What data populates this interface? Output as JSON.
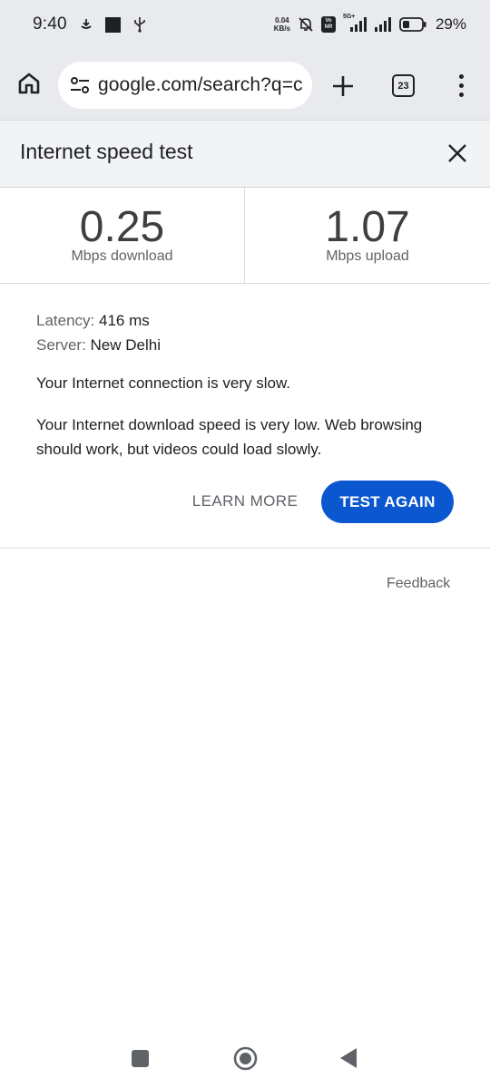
{
  "status_bar": {
    "time": "9:40",
    "net_speed_value": "0.04",
    "net_speed_unit": "KB/s",
    "signal_label": "5G+",
    "vo_top": "Vo",
    "vo_bottom": "NR",
    "battery_percent": "29%",
    "icons": [
      "download-icon",
      "square-notification-icon",
      "usb-icon",
      "mute-icon",
      "signal-icon",
      "battery-icon"
    ]
  },
  "toolbar": {
    "url": "google.com/search?q=c",
    "tab_count": "23",
    "icons": [
      "home-icon",
      "tune-icon",
      "plus-icon",
      "menu-dots-icon"
    ]
  },
  "panel": {
    "title": "Internet speed test",
    "download": {
      "value": "0.25",
      "unit": "Mbps download"
    },
    "upload": {
      "value": "1.07",
      "unit": "Mbps upload"
    },
    "latency_label": "Latency:",
    "latency_value": "416 ms",
    "server_label": "Server:",
    "server_value": "New Delhi",
    "status_message": "Your Internet connection is very slow.",
    "advice_message": "Your Internet download speed is very low. Web browsing should work, but videos could load slowly.",
    "learn_more_label": "LEARN MORE",
    "test_again_label": "TEST AGAIN",
    "feedback_label": "Feedback"
  },
  "colors": {
    "accent": "#0b57d0",
    "chrome_bg": "#e8eaed",
    "title_bg": "#f1f3f4"
  }
}
